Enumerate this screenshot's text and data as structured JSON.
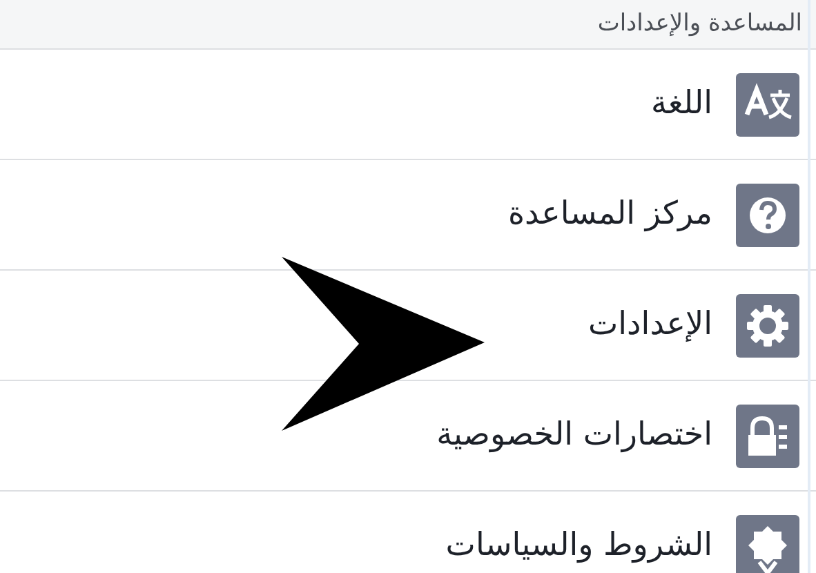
{
  "section_header": "المساعدة والإعدادات",
  "items": [
    {
      "label": "اللغة",
      "kind": "language"
    },
    {
      "label": "مركز المساعدة",
      "kind": "help"
    },
    {
      "label": "الإعدادات",
      "kind": "settings"
    },
    {
      "label": "اختصارات الخصوصية",
      "kind": "privacy"
    },
    {
      "label": "الشروط والسياسات",
      "kind": "terms"
    }
  ]
}
